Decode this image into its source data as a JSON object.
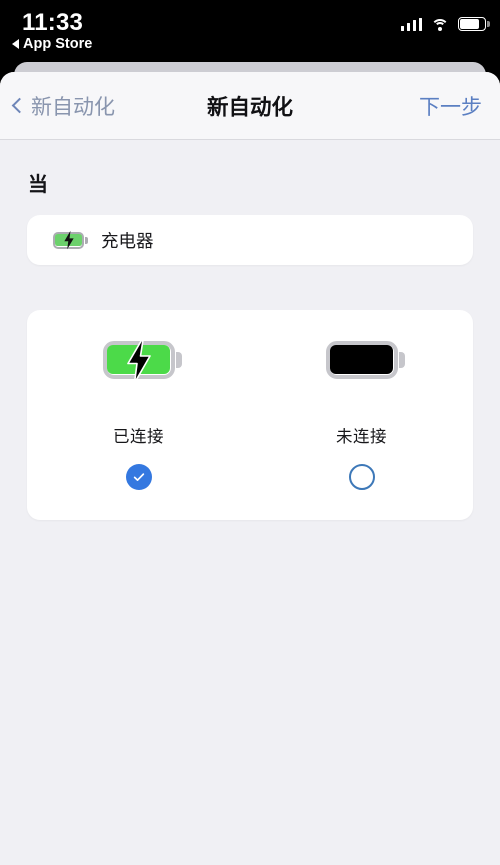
{
  "status_bar": {
    "time": "11:33",
    "back_app_label": "App Store",
    "back_arrow_icon": "triangle-left-icon",
    "signal_icon": "cellular-signal-icon",
    "signal_bars_filled": 4,
    "wifi_icon": "wifi-icon",
    "battery_icon": "battery-icon",
    "battery_level_percent": 78
  },
  "nav_bar": {
    "back_label": "新自动化",
    "back_icon": "chevron-left-icon",
    "title": "新自动化",
    "next_label": "下一步"
  },
  "content": {
    "section_header": "当",
    "trigger": {
      "label": "充电器",
      "icon": "battery-charging-icon"
    },
    "options": [
      {
        "label": "已连接",
        "icon": "battery-charging-green-icon",
        "selected": true,
        "radio_icon": "check-circle-filled-icon"
      },
      {
        "label": "未连接",
        "icon": "battery-full-black-icon",
        "selected": false,
        "radio_icon": "circle-outline-icon"
      }
    ]
  },
  "colors": {
    "accent_blue": "#3478E0",
    "nav_link_blue": "#5B7FC2",
    "nav_back_gray": "#8995AE",
    "battery_green": "#4CDA49",
    "battery_green_small": "#6CD16C",
    "page_background": "#F0F0F4",
    "card_background": "#FFFFFF",
    "nav_background": "#F7F7F9",
    "status_bar_background": "#000000"
  }
}
